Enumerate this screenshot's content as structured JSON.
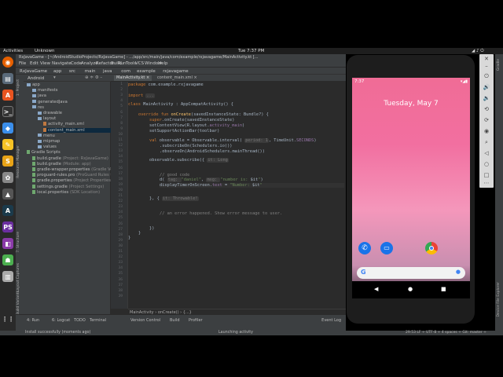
{
  "gnome": {
    "activities": "Activities",
    "app_menu": "Unknown",
    "clock": "Tue  7:37 PM"
  },
  "ide": {
    "title": "RxJavaGame - [~/AndroidStudioProjects/RxJavaGame] - .../app/src/main/java/com/example/rxjavagame/MainActivity.kt [...",
    "menu": [
      "File",
      "Edit",
      "View",
      "Navigate",
      "Code",
      "Analyze",
      "Refactor",
      "Build",
      "Run",
      "Tools",
      "VCS",
      "Window",
      "Help"
    ],
    "nav": [
      "RxJavaGame",
      "app",
      "src",
      "main",
      "java",
      "com",
      "example",
      "rxjavagame"
    ],
    "project_view": "Android",
    "tree": [
      {
        "label": "app",
        "depth": 0,
        "kind": "folder"
      },
      {
        "label": "manifests",
        "depth": 1,
        "kind": "folder"
      },
      {
        "label": "java",
        "depth": 1,
        "kind": "folder"
      },
      {
        "label": "generatedJava",
        "depth": 1,
        "kind": "folder"
      },
      {
        "label": "res",
        "depth": 1,
        "kind": "folder"
      },
      {
        "label": "drawable",
        "depth": 2,
        "kind": "folder"
      },
      {
        "label": "layout",
        "depth": 2,
        "kind": "folder"
      },
      {
        "label": "activity_main.xml",
        "depth": 3,
        "kind": "xml"
      },
      {
        "label": "content_main.xml",
        "depth": 3,
        "kind": "xml"
      },
      {
        "label": "menu",
        "depth": 2,
        "kind": "folder"
      },
      {
        "label": "mipmap",
        "depth": 2,
        "kind": "folder"
      },
      {
        "label": "values",
        "depth": 2,
        "kind": "folder"
      },
      {
        "label": "Gradle Scripts",
        "depth": 0,
        "kind": "gradle"
      },
      {
        "label": "build.gradle",
        "hint": "(Project: RxJavaGame)",
        "depth": 1,
        "kind": "gradle"
      },
      {
        "label": "build.gradle",
        "hint": "(Module: app)",
        "depth": 1,
        "kind": "gradle"
      },
      {
        "label": "gradle-wrapper.properties",
        "hint": "(Gradle Versi",
        "depth": 1,
        "kind": "gradle"
      },
      {
        "label": "proguard-rules.pro",
        "hint": "(ProGuard Rules for",
        "depth": 1,
        "kind": "gradle"
      },
      {
        "label": "gradle.properties",
        "hint": "(Project Properties)",
        "depth": 1,
        "kind": "gradle"
      },
      {
        "label": "settings.gradle",
        "hint": "(Project Settings)",
        "depth": 1,
        "kind": "gradle"
      },
      {
        "label": "local.properties",
        "hint": "(SDK Location)",
        "depth": 1,
        "kind": "gradle"
      }
    ],
    "tabs": [
      "MainActivity.kt",
      "content_main.xml"
    ],
    "breadcrumb": [
      "MainActivity",
      "onCreate()",
      "{...}"
    ],
    "line_numbers": [
      "1",
      "2",
      "3",
      "4",
      "5",
      "6",
      "7",
      "8",
      "9",
      "10",
      "11",
      "12",
      "13",
      "14",
      "15",
      "16",
      "17",
      "18",
      "19",
      "20",
      "21",
      "22",
      "23",
      "24",
      "25",
      "26",
      "27",
      "28",
      "29",
      "30",
      "31",
      "32",
      "33",
      "34",
      "35",
      "36",
      "37",
      "38",
      "39"
    ],
    "bottom_tools": [
      "4: Run",
      "6: Logcat",
      "TODO",
      "Terminal",
      "Version Control",
      "Build",
      "Profiler"
    ],
    "event_log": "Event Log",
    "status_left": "Install successfully (moments ago)",
    "status_mid": "Launching activity",
    "status_right": "29:53  LF ÷  UTF-8 ÷  4 spaces ÷  Git: master ÷"
  },
  "emulator": {
    "time": "7:37",
    "date": "Tuesday, May 7"
  }
}
